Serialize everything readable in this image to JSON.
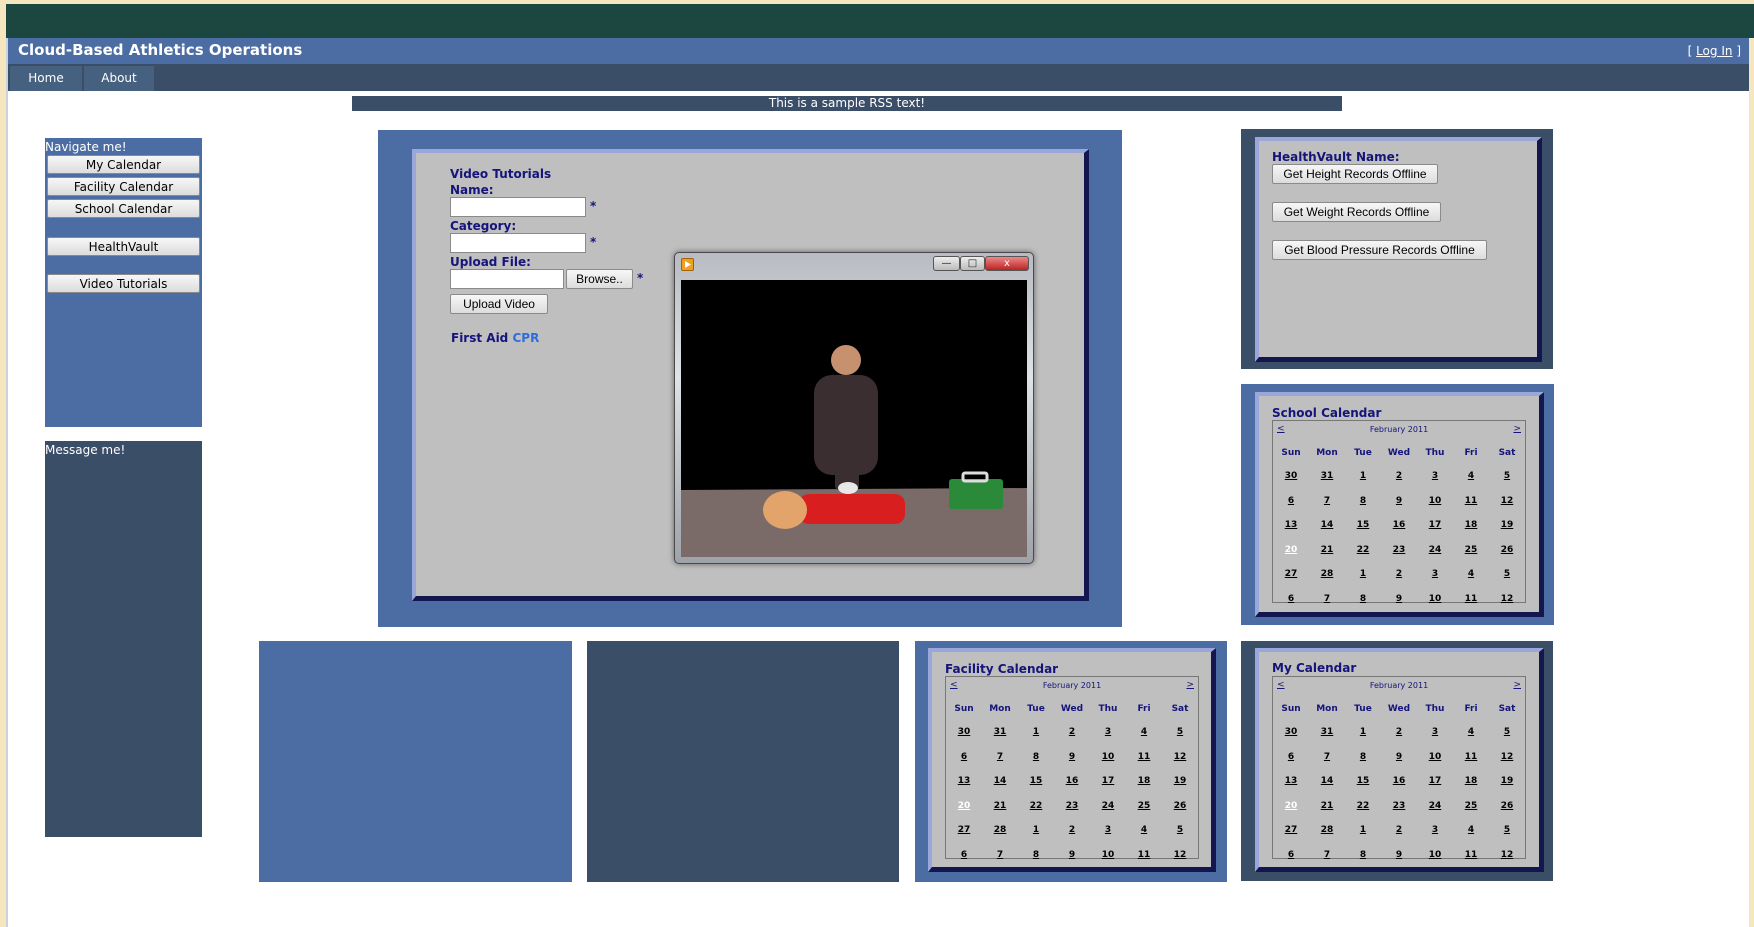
{
  "header": {
    "title": "Cloud-Based Athletics Operations",
    "login_prefix": "[",
    "login_link": "Log In",
    "login_suffix": "]"
  },
  "menu": [
    {
      "label": "Home"
    },
    {
      "label": "About"
    }
  ],
  "rss_text": "This is a sample RSS text!",
  "nav": {
    "label": "Navigate me!",
    "buttons": [
      "My Calendar",
      "Facility Calendar",
      "School Calendar",
      "HealthVault",
      "Video Tutorials"
    ]
  },
  "message": {
    "label": "Message me!"
  },
  "video": {
    "heading": "Video Tutorials",
    "name_label": "Name:",
    "category_label": "Category:",
    "upload_label": "Upload File:",
    "browse_label": "Browse..",
    "upload_button": "Upload Video",
    "required_mark": "*",
    "first_aid": "First Aid",
    "cpr": "CPR",
    "player_min": "—",
    "player_max": "□",
    "player_close": "x"
  },
  "healthvault": {
    "label": "HealthVault Name:",
    "buttons": [
      "Get Height Records Offline",
      "Get Weight Records Offline",
      "Get Blood Pressure Records Offline"
    ]
  },
  "calendars": {
    "school": {
      "title": "School Calendar"
    },
    "facility": {
      "title": "Facility Calendar"
    },
    "my": {
      "title": "My Calendar"
    },
    "month": "February 2011",
    "prev": "<",
    "next": ">",
    "days": [
      "Sun",
      "Mon",
      "Tue",
      "Wed",
      "Thu",
      "Fri",
      "Sat"
    ],
    "weeks": [
      [
        "30",
        "31",
        "1",
        "2",
        "3",
        "4",
        "5"
      ],
      [
        "6",
        "7",
        "8",
        "9",
        "10",
        "11",
        "12"
      ],
      [
        "13",
        "14",
        "15",
        "16",
        "17",
        "18",
        "19"
      ],
      [
        "20",
        "21",
        "22",
        "23",
        "24",
        "25",
        "26"
      ],
      [
        "27",
        "28",
        "1",
        "2",
        "3",
        "4",
        "5"
      ],
      [
        "6",
        "7",
        "8",
        "9",
        "10",
        "11",
        "12"
      ]
    ],
    "today": "20"
  },
  "colors": {
    "accent": "#4b6da3",
    "dark": "#3b4e68",
    "topbar": "#1b4740",
    "heading": "#14147a"
  }
}
